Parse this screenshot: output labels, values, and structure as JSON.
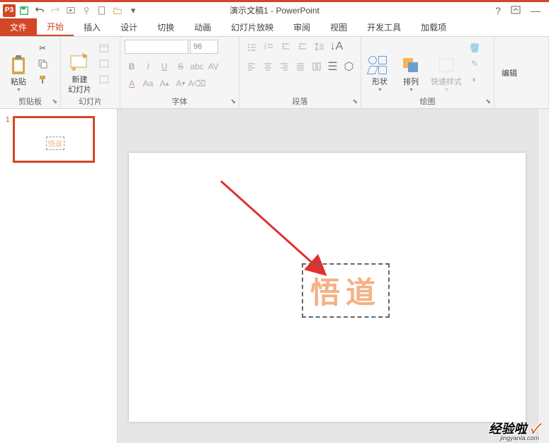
{
  "app": {
    "initials": "P3",
    "title": "演示文稿1 - PowerPoint"
  },
  "tabs": {
    "file": "文件",
    "items": [
      "开始",
      "插入",
      "设计",
      "切换",
      "动画",
      "幻灯片放映",
      "审阅",
      "视图",
      "开发工具",
      "加载项"
    ],
    "active": 0
  },
  "groups": {
    "clipboard": {
      "label": "剪贴板",
      "paste": "粘贴"
    },
    "slides": {
      "label": "幻灯片",
      "new_slide": "新建\n幻灯片"
    },
    "font": {
      "label": "字体",
      "size": "96"
    },
    "paragraph": {
      "label": "段落"
    },
    "drawing": {
      "label": "绘图",
      "shapes": "形状",
      "arrange": "排列",
      "quick": "快速样式"
    },
    "editing": {
      "label": "编辑"
    }
  },
  "slide": {
    "number": "1",
    "text": "悟道",
    "thumb_text": "悟道"
  },
  "watermark": {
    "main": "经验啦",
    "sub": "jingyanla.com"
  }
}
